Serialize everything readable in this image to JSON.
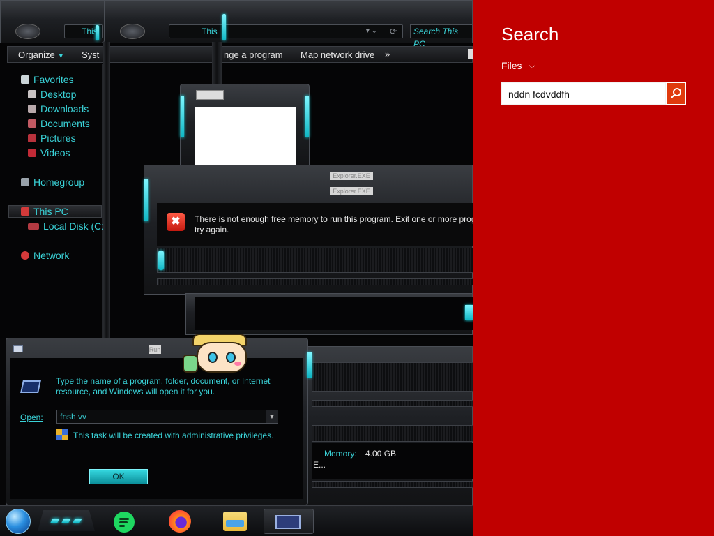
{
  "explorer": {
    "address_text": "This",
    "address_text2": "This",
    "search_placeholder": "Search This PC",
    "toolbar": {
      "organize": "Organize",
      "system": "Syst",
      "change_program": "nge a program",
      "map_drive": "Map network drive",
      "more": "»"
    },
    "nav": {
      "favorites": "Favorites",
      "desktop": "Desktop",
      "downloads": "Downloads",
      "documents": "Documents",
      "pictures": "Pictures",
      "videos": "Videos",
      "homegroup": "Homegroup",
      "this_pc": "This PC",
      "local_disk": "Local Disk (C:",
      "network": "Network"
    },
    "details": {
      "memory_label": "Memory:",
      "memory_value": "4.00 GB",
      "ellipsis": "E..."
    }
  },
  "error_dialog": {
    "title1": "Explorer.EXE",
    "title2": "Explorer.EXE",
    "message_line1": "There is not enough free memory to run this program. Exit one or more prog",
    "message_line2": "try again."
  },
  "run_dialog": {
    "title": "Run",
    "description_line1": "Type the name of a program, folder, document, or Internet",
    "description_line2": "resource, and Windows will open it for you.",
    "open_label": "Open:",
    "open_value": "fnsh vv",
    "admin_note": "This task will be created with administrative privileges.",
    "ok_label": "OK"
  },
  "search_pane": {
    "title": "Search",
    "scope": "Files",
    "query": "nddn fcdvddfh"
  },
  "taskbar": {
    "apps": [
      "start-orb",
      "spotify",
      "firefox",
      "file-explorer",
      "run"
    ]
  },
  "colors": {
    "accent_teal": "#3ad3d8",
    "search_red": "#c00000",
    "search_button": "#e03a0e"
  }
}
